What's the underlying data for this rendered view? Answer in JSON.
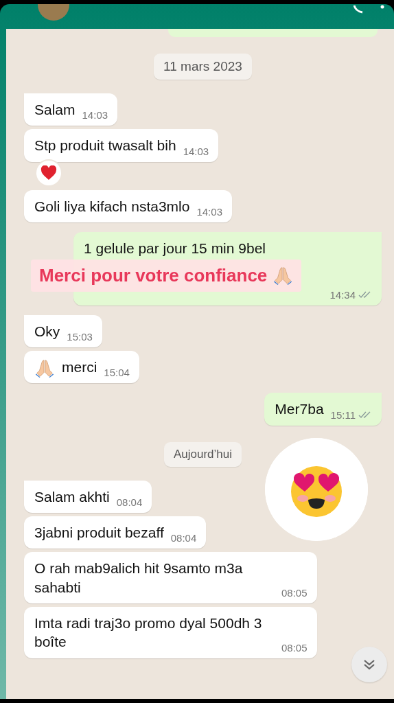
{
  "messages": [
    {
      "kind": "date",
      "text": "11 mars 2023"
    },
    {
      "kind": "in",
      "tail": true,
      "text": "Salam",
      "time": "14:03",
      "heart_reaction": false,
      "pray_emoji": false
    },
    {
      "kind": "in",
      "tail": false,
      "text": "Stp produit twasalt bih",
      "time": "14:03",
      "heart_reaction": true,
      "pray_emoji": false
    },
    {
      "kind": "in",
      "tail": false,
      "text": "Goli liya kifach nsta3mlo",
      "time": "14:03",
      "heart_reaction": false,
      "pray_emoji": false
    },
    {
      "kind": "out",
      "tail": true,
      "text": "1 gelule par jour 15 min 9bel",
      "time": "14:34",
      "heart_reaction": false,
      "pray_emoji": false,
      "overlay": "Merci pour votre confiance"
    },
    {
      "kind": "in",
      "tail": true,
      "text": "Oky",
      "time": "15:03",
      "heart_reaction": false,
      "pray_emoji": false
    },
    {
      "kind": "in",
      "tail": false,
      "text": "merci",
      "time": "15:04",
      "heart_reaction": false,
      "pray_emoji": true
    },
    {
      "kind": "out",
      "tail": true,
      "text": "Mer7ba",
      "time": "15:11",
      "heart_reaction": false,
      "pray_emoji": false
    },
    {
      "kind": "date",
      "text": "Aujourd’hui"
    },
    {
      "kind": "sticker"
    },
    {
      "kind": "in",
      "tail": true,
      "text": "Salam akhti",
      "time": "08:04",
      "heart_reaction": false,
      "pray_emoji": false
    },
    {
      "kind": "in",
      "tail": false,
      "text": "3jabni produit bezaff",
      "time": "08:04",
      "heart_reaction": false,
      "pray_emoji": false
    },
    {
      "kind": "in",
      "tail": false,
      "text": "O rah mab9alich hit 9samto m3a sahabti",
      "time": "08:05",
      "heart_reaction": false,
      "pray_emoji": false
    },
    {
      "kind": "in",
      "tail": false,
      "text": "Imta radi traj3o promo dyal 500dh 3 boîte",
      "time": "08:05",
      "heart_reaction": false,
      "pray_emoji": false
    }
  ]
}
